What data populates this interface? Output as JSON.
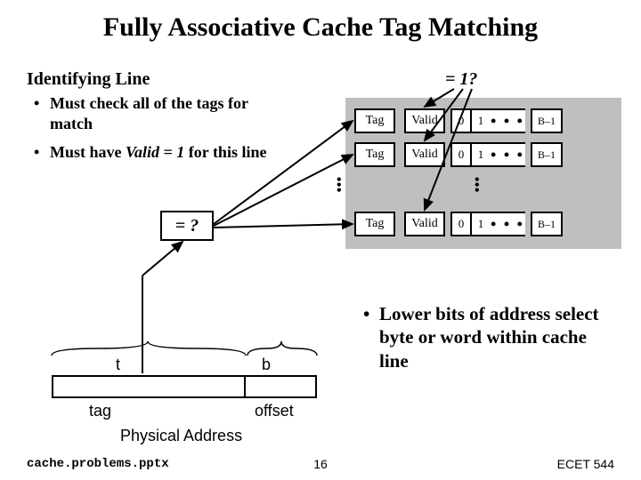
{
  "title": "Fully Associative Cache Tag Matching",
  "left": {
    "heading": "Identifying Line",
    "b1a": "Must check all of the tags for",
    "b1b": "match",
    "b2a": "Must have ",
    "b2b": "Valid = 1",
    "b2c": " for this line"
  },
  "eq1": "= 1?",
  "eqq": "= ?",
  "cache": {
    "tag": "Tag",
    "valid": "Valid",
    "c0": "0",
    "c1": "1",
    "cdots": "• • •",
    "clast": "B–1"
  },
  "lower": "Lower bits of address select byte or word within cache line",
  "addr": {
    "t": "t",
    "b": "b",
    "tag": "tag",
    "offset": "offset",
    "phys": "Physical Address"
  },
  "footer": {
    "file": "cache.problems.pptx",
    "page": "16",
    "course": "ECET 544"
  }
}
